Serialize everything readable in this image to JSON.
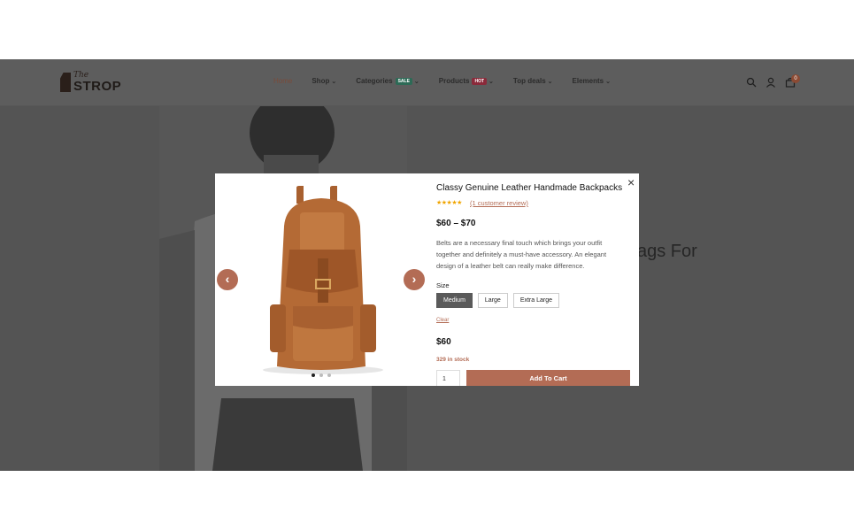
{
  "header": {
    "logo_small": "The",
    "logo_big": "STROP",
    "nav": [
      {
        "label": "Home"
      },
      {
        "label": "Shop"
      },
      {
        "label": "Categories",
        "badge": "SALE"
      },
      {
        "label": "Products",
        "badge": "HOT"
      },
      {
        "label": "Top deals"
      },
      {
        "label": "Elements"
      }
    ],
    "cart_count": "0",
    "icons": [
      "search-icon",
      "user-icon",
      "cart-icon"
    ]
  },
  "hero": {
    "partial_text": "ags For"
  },
  "modal": {
    "close_symbol": "×",
    "title": "Classy Genuine Leather Handmade Backpacks",
    "stars": "★★★★★",
    "rating_value": 5,
    "review_link": "(1 customer review)",
    "price_range": "$60 – $70",
    "description": "Belts are a necessary final touch which brings your outfit together and definitely a must-have accessory. An elegant design of a leather belt can really make difference.",
    "size_label": "Size",
    "sizes": [
      "Medium",
      "Large",
      "Extra Large"
    ],
    "selected_size": "Medium",
    "clear_label": "Clear",
    "price": "$60",
    "stock": "329 in stock",
    "quantity": "1",
    "add_to_cart": "Add To Cart",
    "prev_arrow": "‹",
    "next_arrow": "›",
    "gallery_dots": 3,
    "active_dot": 1
  },
  "colors": {
    "accent": "#b36c55",
    "overlay": "#5e5e5e",
    "star": "#f0a500"
  }
}
